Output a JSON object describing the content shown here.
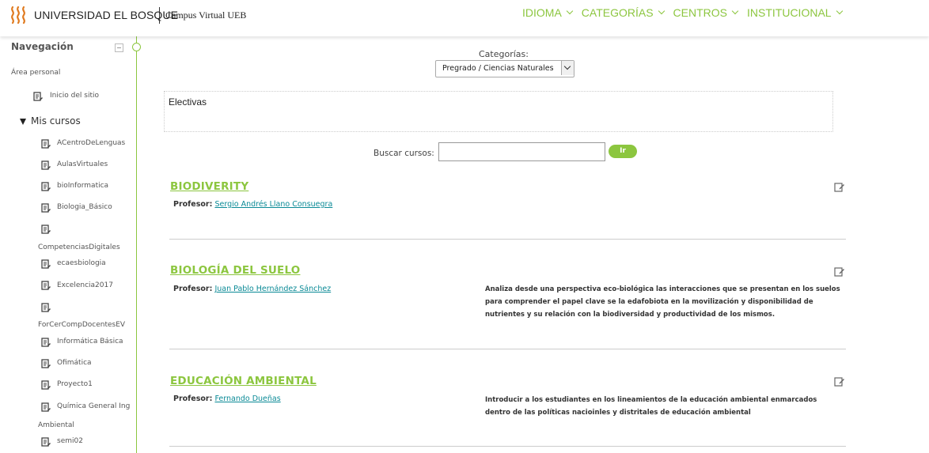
{
  "header": {
    "brand": "UNIVERSIDAD EL BOSQUE",
    "subtitle": "Campus Virtual UEB",
    "nav": [
      {
        "label": "IDIOMA"
      },
      {
        "label": "CATEGORÍAS"
      },
      {
        "label": "CENTROS"
      },
      {
        "label": "INSTITUCIONAL"
      }
    ],
    "accent_color": "#8cc63f"
  },
  "sidebar": {
    "title": "Navegación",
    "area": "Área personal",
    "home": "Inicio del sitio",
    "my_courses": "Mis cursos",
    "courses": [
      "ACentroDeLenguas",
      "AulasVirtuales",
      "bioInformatica",
      "Biologia_Básico",
      "CompetenciasDigitales",
      "ecaesbiologia",
      "Excelencia2017",
      "ForCerCompDocentesEV",
      "Informática Básica",
      "Ofimática",
      "Proyecto1",
      "Química General Ing",
      "Ambiental",
      "semi02"
    ]
  },
  "main": {
    "category_label": "Categorías:",
    "category_value": "Pregrado / Ciencias Naturales",
    "category_description": "Electivas",
    "search_label": "Buscar cursos:",
    "search_value": "",
    "go_label": "Ir",
    "courses": [
      {
        "title": "BIODIVERITY",
        "teacher_label": "Profesor:",
        "teacher": "Sergio Andrés Llano Consuegra",
        "summary": ""
      },
      {
        "title": "BIOLOGÍA DEL SUELO",
        "teacher_label": "Profesor:",
        "teacher": "Juan Pablo Hernández Sánchez",
        "summary": "Analiza desde una perspectiva eco-biológica las interacciones que se presentan en los suelos para comprender el papel clave se la edafobiota en la movilización y disponibilidad de nutrientes y su relación con la biodiversidad y productividad de los mismos."
      },
      {
        "title": "EDUCACIÓN AMBIENTAL",
        "teacher_label": "Profesor:",
        "teacher": "Fernando Dueñas",
        "summary": "Introducir a los estudiantes en los lineamientos de la educación ambiental enmarcados dentro de las políticas nacioinles y distritales de educación ambiental"
      }
    ]
  }
}
